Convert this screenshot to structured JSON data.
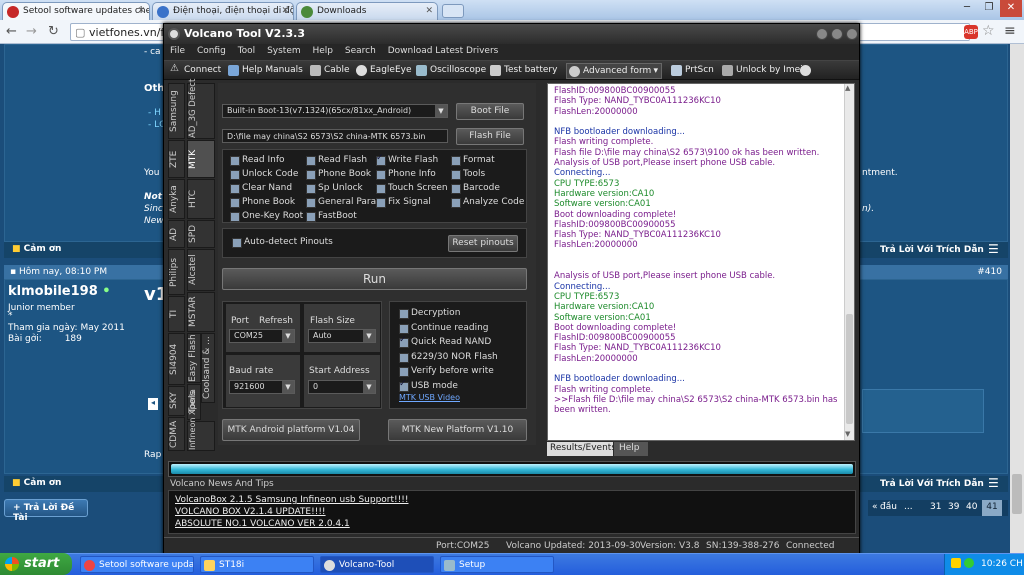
{
  "browser": {
    "tabs": [
      {
        "label": "Setool software updates che",
        "active": true
      },
      {
        "label": "Điện thoại, điện thoại di động",
        "active": false
      },
      {
        "label": "Downloads",
        "active": false
      }
    ],
    "url": "vietfones.vn/f"
  },
  "forum": {
    "snips": {
      "a": "- ca",
      "b": "Oth",
      "c": "- H",
      "d": "- LC",
      "e": "You",
      "f": "Not",
      "g": "Sinc",
      "h": "New",
      "i": "ntment.",
      "j": "n).",
      "k": "Rap"
    },
    "thanks_label": "Cảm ơn",
    "reply_quote_label": "Trả Lời Với Trích Dẫn",
    "post_header": {
      "time": "Hôm nay, 08:10 PM",
      "number": "#410"
    },
    "user": {
      "name": "klmobile198",
      "title": "Junior member",
      "star": "*",
      "join_label": "Tham gia ngày:",
      "join_value": "May 2011",
      "posts_label": "Bài gởi:",
      "posts_value": "189"
    },
    "post_text": "v1",
    "reply_thread_label": "Trả Lời Đề Tài",
    "pager": {
      "first": "đầu",
      "dots": "...",
      "pages": [
        "31",
        "39",
        "40",
        "41"
      ]
    }
  },
  "volcano": {
    "title": "Volcano Tool V2.3.3",
    "menu": [
      "File",
      "Config",
      "Tool",
      "System",
      "Help",
      "Search",
      "Download Latest Drivers"
    ],
    "toolbar": [
      "Connect",
      "Help Manuals",
      "Cable",
      "EagleEye",
      "Oscilloscope",
      "Test battery",
      "Advanced form",
      "PrtScn",
      "Unlock by Imei"
    ],
    "vtabs_left": [
      "Samsung",
      "ZTE",
      "Anyka",
      "AD",
      "Philips",
      "TI",
      "SI4904",
      "SKY",
      "CDMA"
    ],
    "vtabs_right": [
      "AD_3G Defect",
      "MTK",
      "HTC",
      "SPD",
      "Alcatel",
      "MSTAR",
      "Easy Flash",
      "Coolsand & ...",
      "Tools",
      "Infineon Xperia"
    ],
    "boot_select": "Built-in Boot-13(v7.1324)(65cx/81xx_Android)",
    "boot_file_btn": "Boot File",
    "flash_path": "D:\\file may china\\S2 6573\\S2 china-MTK 6573.bin",
    "flash_file_btn": "Flash File",
    "checks": [
      {
        "label": "Read Info",
        "checked": false
      },
      {
        "label": "Read Flash",
        "checked": false
      },
      {
        "label": "Write Flash",
        "checked": true
      },
      {
        "label": "Format",
        "checked": false
      },
      {
        "label": "Unlock Code",
        "checked": false
      },
      {
        "label": "Phone Book",
        "checked": false
      },
      {
        "label": "Phone Info",
        "checked": false
      },
      {
        "label": "Tools",
        "checked": false
      },
      {
        "label": "Clear Nand",
        "checked": false
      },
      {
        "label": "Sp Unlock",
        "checked": false
      },
      {
        "label": "Touch Screen",
        "checked": false
      },
      {
        "label": "Barcode",
        "checked": false
      },
      {
        "label": "Phone Book",
        "checked": false
      },
      {
        "label": "General Para.",
        "checked": false
      },
      {
        "label": "Fix Signal",
        "checked": false
      },
      {
        "label": "Analyze Code",
        "checked": false
      },
      {
        "label": "One-Key Root",
        "checked": false
      },
      {
        "label": "FastBoot",
        "checked": false
      }
    ],
    "auto_detect": "Auto-detect Pinouts",
    "reset_pinouts": "Reset pinouts",
    "run": "Run",
    "port_label": "Port",
    "refresh_label": "Refresh",
    "port_value": "COM25",
    "flash_size_label": "Flash Size",
    "flash_size_value": "Auto",
    "baud_label": "Baud rate",
    "baud_value": "921600",
    "start_label": "Start Address",
    "start_value": "0",
    "options": [
      {
        "label": "Decryption",
        "checked": false
      },
      {
        "label": "Continue reading",
        "checked": false
      },
      {
        "label": "Quick Read NAND",
        "checked": true
      },
      {
        "label": "6229/30 NOR Flash",
        "checked": false
      },
      {
        "label": "Verify before write",
        "checked": false
      },
      {
        "label": "USB mode",
        "checked": true
      }
    ],
    "usb_video": "MTK USB Video",
    "android_btn": "MTK Android platform V1.04",
    "new_platform_btn": "MTK New Platform V1.10",
    "log": [
      {
        "t": "FlashID:009800BC00900055",
        "c": "purple"
      },
      {
        "t": "Flash Type: NAND_TYBC0A111236KC10",
        "c": "purple"
      },
      {
        "t": "FlashLen:20000000",
        "c": "purple"
      },
      {
        "t": "",
        "c": "purple"
      },
      {
        "t": "NFB bootloader downloading...",
        "c": "blue"
      },
      {
        "t": "Flash writing complete.",
        "c": "purple"
      },
      {
        "t": "Flash file D:\\file may china\\S2 6573\\9100 ok has been written.",
        "c": "purple"
      },
      {
        "t": "Analysis of USB port,Please insert phone USB cable.",
        "c": "purple"
      },
      {
        "t": "Connecting...",
        "c": "blue"
      },
      {
        "t": "CPU TYPE:6573",
        "c": "green"
      },
      {
        "t": "Hardware version:CA10",
        "c": "green"
      },
      {
        "t": "Software version:CA01",
        "c": "green"
      },
      {
        "t": "Boot downloading complete!",
        "c": "purple"
      },
      {
        "t": "FlashID:009800BC00900055",
        "c": "purple"
      },
      {
        "t": "Flash Type: NAND_TYBC0A111236KC10",
        "c": "purple"
      },
      {
        "t": "FlashLen:20000000",
        "c": "purple"
      },
      {
        "t": "",
        "c": "purple"
      },
      {
        "t": "",
        "c": "purple"
      },
      {
        "t": "Analysis of USB port,Please insert phone USB cable.",
        "c": "purple"
      },
      {
        "t": "Connecting...",
        "c": "blue"
      },
      {
        "t": "CPU TYPE:6573",
        "c": "green"
      },
      {
        "t": "Hardware version:CA10",
        "c": "green"
      },
      {
        "t": "Software version:CA01",
        "c": "green"
      },
      {
        "t": "Boot downloading complete!",
        "c": "purple"
      },
      {
        "t": "FlashID:009800BC00900055",
        "c": "purple"
      },
      {
        "t": "Flash Type: NAND_TYBC0A111236KC10",
        "c": "purple"
      },
      {
        "t": "FlashLen:20000000",
        "c": "purple"
      },
      {
        "t": "",
        "c": "purple"
      },
      {
        "t": "NFB bootloader downloading...",
        "c": "blue"
      },
      {
        "t": "Flash writing complete.",
        "c": "purple"
      },
      {
        "t": ">>Flash file D:\\file may china\\S2 6573\\S2 china-MTK 6573.bin has",
        "c": "purple"
      },
      {
        "t": "been written.",
        "c": "purple"
      }
    ],
    "log_tabs": [
      "Results/Events",
      "Help"
    ],
    "news_title": "Volcano News And Tips",
    "news": [
      "VolcanoBox 2.1.5 Samsung Infineon usb Support!!!!",
      "VOLCANO BOX V2.1.4 UPDATE!!!!",
      "ABSOLUTE NO.1 VOLCANO VER 2.0.4.1"
    ],
    "status": {
      "port": "Port:COM25",
      "updated": "Volcano Updated: 2013-09-30",
      "version": "Version: V3.8",
      "sn": "SN:139-388-276",
      "conn": "Connected"
    }
  },
  "taskbar": {
    "start": "start",
    "tasks": [
      "Setool software upda...",
      "ST18i",
      "Volcano-Tool",
      "Setup"
    ],
    "clock": "10:26 CH"
  }
}
